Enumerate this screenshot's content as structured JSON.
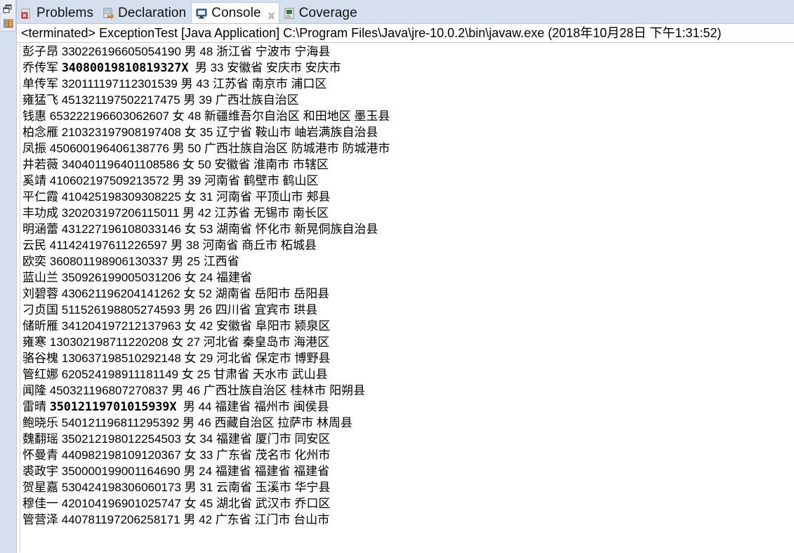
{
  "window": {
    "background_color": "#ffffff",
    "chrome_color": "#d6dfee",
    "border_color": "#b8c6dc"
  },
  "left_toolbar": {
    "name": "minimized-view-stack",
    "items": [
      {
        "icon": "restore-icon",
        "label": "Restore"
      },
      {
        "icon": "outline-view-icon",
        "label": "Outline"
      }
    ]
  },
  "tabs": [
    {
      "id": "problems",
      "label": "Problems",
      "icon": "problems-icon",
      "active": false,
      "closable": false
    },
    {
      "id": "declaration",
      "label": "Declaration",
      "icon": "declaration-icon",
      "active": false,
      "closable": false
    },
    {
      "id": "console",
      "label": "Console",
      "icon": "console-icon",
      "active": true,
      "closable": true
    },
    {
      "id": "coverage",
      "label": "Coverage",
      "icon": "coverage-icon",
      "active": false,
      "closable": false
    }
  ],
  "console": {
    "header": "<terminated> ExceptionTest [Java Application] C:\\Program Files\\Java\\jre-10.0.2\\bin\\javaw.exe (2018年10月28日 下午1:31:52)",
    "lines": [
      {
        "name": "彭子昂",
        "id": "330226196605054190",
        "id_bold": false,
        "gender": "男",
        "age": "48",
        "province": "浙江省",
        "city": "宁波市",
        "district": "宁海县"
      },
      {
        "name": "乔传军",
        "id": "34080019810819327X",
        "id_bold": true,
        "gender": "男",
        "age": "33",
        "province": "安徽省",
        "city": "安庆市",
        "district": "安庆市"
      },
      {
        "name": "单传军",
        "id": "320111197112301539",
        "id_bold": false,
        "gender": "男",
        "age": "43",
        "province": "江苏省",
        "city": "南京市",
        "district": "浦口区"
      },
      {
        "name": "雍猛飞",
        "id": "451321197502217475",
        "id_bold": false,
        "gender": "男",
        "age": "39",
        "province": "广西壮族自治区",
        "city": "",
        "district": ""
      },
      {
        "name": "钱惠",
        "id": "653222196603062607",
        "id_bold": false,
        "gender": "女",
        "age": "48",
        "province": "新疆维吾尔自治区",
        "city": "和田地区",
        "district": "墨玉县"
      },
      {
        "name": "柏念雁",
        "id": "210323197908197408",
        "id_bold": false,
        "gender": "女",
        "age": "35",
        "province": "辽宁省",
        "city": "鞍山市",
        "district": "岫岩满族自治县"
      },
      {
        "name": "凤振",
        "id": "450600196406138776",
        "id_bold": false,
        "gender": "男",
        "age": "50",
        "province": "广西壮族自治区",
        "city": "防城港市",
        "district": "防城港市"
      },
      {
        "name": "井若薇",
        "id": "340401196401108586",
        "id_bold": false,
        "gender": "女",
        "age": "50",
        "province": "安徽省",
        "city": "淮南市",
        "district": "市辖区"
      },
      {
        "name": "奚靖",
        "id": "410602197509213572",
        "id_bold": false,
        "gender": "男",
        "age": "39",
        "province": "河南省",
        "city": "鹤壁市",
        "district": "鹤山区"
      },
      {
        "name": "平仁霞",
        "id": "410425198309308225",
        "id_bold": false,
        "gender": "女",
        "age": "31",
        "province": "河南省",
        "city": "平顶山市",
        "district": "郏县"
      },
      {
        "name": "丰功成",
        "id": "320203197206115011",
        "id_bold": false,
        "gender": "男",
        "age": "42",
        "province": "江苏省",
        "city": "无锡市",
        "district": "南长区"
      },
      {
        "name": "明涵蕾",
        "id": "431227196108033146",
        "id_bold": false,
        "gender": "女",
        "age": "53",
        "province": "湖南省",
        "city": "怀化市",
        "district": "新晃侗族自治县"
      },
      {
        "name": "云民",
        "id": "411424197611226597",
        "id_bold": false,
        "gender": "男",
        "age": "38",
        "province": "河南省",
        "city": "商丘市",
        "district": "柘城县"
      },
      {
        "name": "欧奕",
        "id": "360801198906130337",
        "id_bold": false,
        "gender": "男",
        "age": "25",
        "province": "江西省",
        "city": "",
        "district": ""
      },
      {
        "name": "蓝山兰",
        "id": "350926199005031206",
        "id_bold": false,
        "gender": "女",
        "age": "24",
        "province": "福建省",
        "city": "",
        "district": ""
      },
      {
        "name": "刘碧蓉",
        "id": "430621196204141262",
        "id_bold": false,
        "gender": "女",
        "age": "52",
        "province": "湖南省",
        "city": "岳阳市",
        "district": "岳阳县"
      },
      {
        "name": "刁贞国",
        "id": "511526198805274593",
        "id_bold": false,
        "gender": "男",
        "age": "26",
        "province": "四川省",
        "city": "宜宾市",
        "district": "珙县"
      },
      {
        "name": "储昕雁",
        "id": "341204197212137963",
        "id_bold": false,
        "gender": "女",
        "age": "42",
        "province": "安徽省",
        "city": "阜阳市",
        "district": "颍泉区"
      },
      {
        "name": "雍寒",
        "id": "130302198711220208",
        "id_bold": false,
        "gender": "女",
        "age": "27",
        "province": "河北省",
        "city": "秦皇岛市",
        "district": "海港区"
      },
      {
        "name": "骆谷槐",
        "id": "130637198510292148",
        "id_bold": false,
        "gender": "女",
        "age": "29",
        "province": "河北省",
        "city": "保定市",
        "district": "博野县"
      },
      {
        "name": "管红娜",
        "id": "620524198911181149",
        "id_bold": false,
        "gender": "女",
        "age": "25",
        "province": "甘肃省",
        "city": "天水市",
        "district": "武山县"
      },
      {
        "name": "闻隆",
        "id": "450321196807270837",
        "id_bold": false,
        "gender": "男",
        "age": "46",
        "province": "广西壮族自治区",
        "city": "桂林市",
        "district": "阳朔县"
      },
      {
        "name": "雷晴",
        "id": "35012119701015939X",
        "id_bold": true,
        "gender": "男",
        "age": "44",
        "province": "福建省",
        "city": "福州市",
        "district": "闽侯县"
      },
      {
        "name": "鲍晓乐",
        "id": "540121196811295392",
        "id_bold": false,
        "gender": "男",
        "age": "46",
        "province": "西藏自治区",
        "city": "拉萨市",
        "district": "林周县"
      },
      {
        "name": "魏翻瑶",
        "id": "350212198012254503",
        "id_bold": false,
        "gender": "女",
        "age": "34",
        "province": "福建省",
        "city": "厦门市",
        "district": "同安区"
      },
      {
        "name": "怀曼青",
        "id": "440982198109120367",
        "id_bold": false,
        "gender": "女",
        "age": "33",
        "province": "广东省",
        "city": "茂名市",
        "district": "化州市"
      },
      {
        "name": "裘政宇",
        "id": "350000199001164690",
        "id_bold": false,
        "gender": "男",
        "age": "24",
        "province": "福建省",
        "city": "福建省",
        "district": "福建省"
      },
      {
        "name": "贺星嘉",
        "id": "530424198306060173",
        "id_bold": false,
        "gender": "男",
        "age": "31",
        "province": "云南省",
        "city": "玉溪市",
        "district": "华宁县"
      },
      {
        "name": "穆佳一",
        "id": "420104196901025747",
        "id_bold": false,
        "gender": "女",
        "age": "45",
        "province": "湖北省",
        "city": "武汉市",
        "district": "乔口区"
      },
      {
        "name": "管营泽",
        "id": "440781197206258171",
        "id_bold": false,
        "gender": "男",
        "age": "42",
        "province": "广东省",
        "city": "江门市",
        "district": "台山市"
      }
    ]
  }
}
